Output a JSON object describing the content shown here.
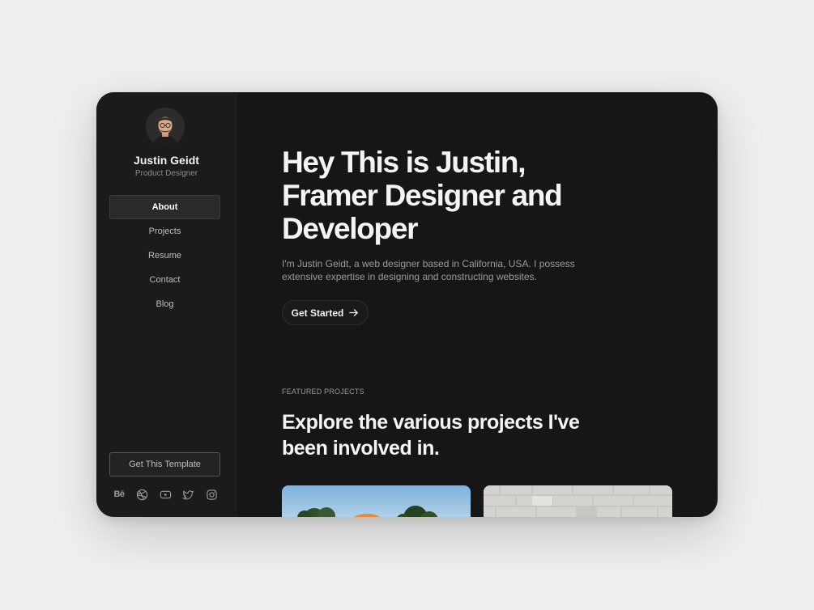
{
  "profile": {
    "name": "Justin Geidt",
    "role": "Product Designer"
  },
  "nav": {
    "items": [
      {
        "label": "About",
        "active": true
      },
      {
        "label": "Projects",
        "active": false
      },
      {
        "label": "Resume",
        "active": false
      },
      {
        "label": "Contact",
        "active": false
      },
      {
        "label": "Blog",
        "active": false
      }
    ]
  },
  "sidebar_footer": {
    "template_button": "Get This Template",
    "socials": [
      {
        "icon": "behance-icon",
        "text": "Bē"
      },
      {
        "icon": "dribbble-icon"
      },
      {
        "icon": "youtube-icon"
      },
      {
        "icon": "twitter-icon"
      },
      {
        "icon": "instagram-icon"
      }
    ]
  },
  "hero": {
    "title": "Hey This is Justin, Framer Designer and Developer",
    "description": "I'm Justin Geidt, a web designer based in California, USA. I possess extensive expertise in designing and constructing websites.",
    "cta_label": "Get Started"
  },
  "featured": {
    "eyebrow": "FEATURED PROJECTS",
    "title": "Explore the various projects I've been involved in."
  },
  "colors": {
    "page_background": "#efefef",
    "window_background": "#161616",
    "sidebar_background": "#1b1b1b",
    "text_primary": "#f4f4f4",
    "text_muted": "#9b9b9b"
  }
}
